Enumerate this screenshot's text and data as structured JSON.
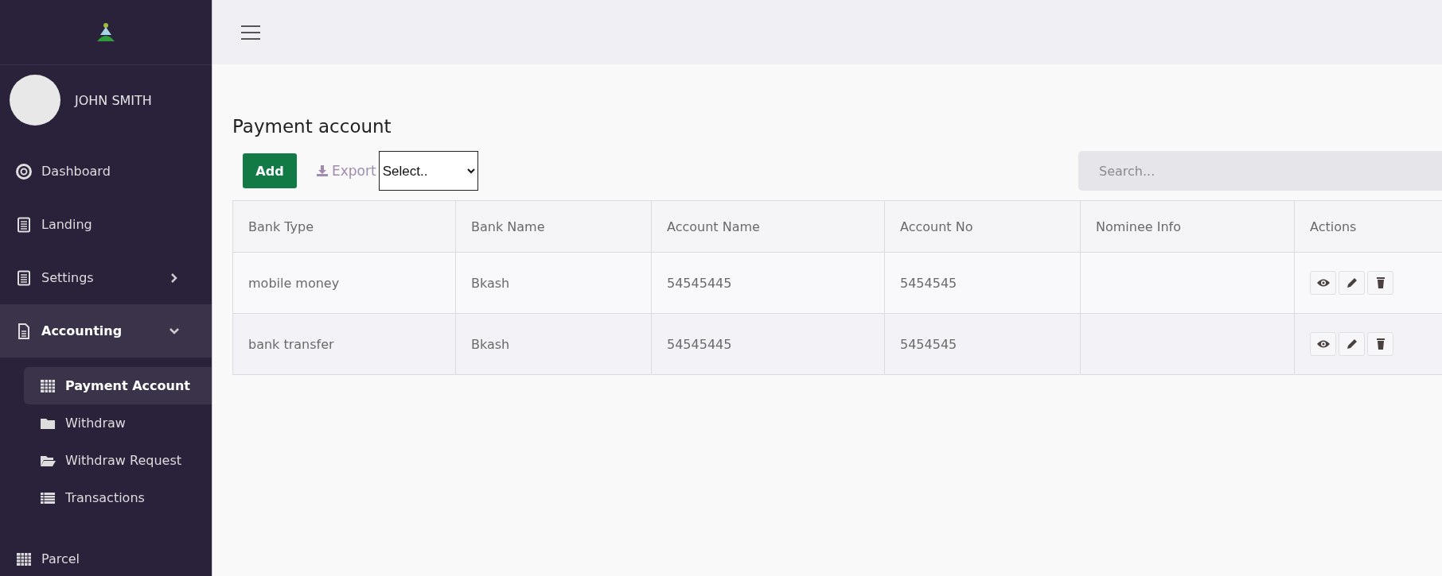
{
  "sidebar": {
    "user": {
      "name": "JOHN SMITH"
    },
    "items": [
      {
        "label": "Dashboard",
        "kind": "link",
        "selected": false
      },
      {
        "label": "Landing",
        "kind": "link",
        "selected": false
      },
      {
        "label": "Settings",
        "kind": "group",
        "selected": false,
        "expanded": false
      },
      {
        "label": "Accounting",
        "kind": "group",
        "selected": true,
        "expanded": true,
        "children": [
          {
            "label": "Payment Account",
            "selected": true
          },
          {
            "label": "Withdraw",
            "selected": false
          },
          {
            "label": "Withdraw Request",
            "selected": false
          },
          {
            "label": "Transactions",
            "selected": false
          }
        ]
      },
      {
        "label": "Parcel",
        "kind": "link",
        "selected": false
      }
    ]
  },
  "page": {
    "title": "Payment account",
    "toolbar": {
      "add_button": "Add",
      "export_label": "Export",
      "select": {
        "value": "Select.."
      },
      "search": {
        "placeholder": "Search..."
      }
    },
    "table": {
      "columns": [
        "Bank Type",
        "Bank Name",
        "Account Name",
        "Account No",
        "Nominee Info",
        "Actions"
      ],
      "rows": [
        {
          "cells": [
            "mobile money",
            "Bkash",
            "54545445",
            "5454545",
            ""
          ]
        },
        {
          "cells": [
            "bank transfer",
            "Bkash",
            "54545445",
            "5454545",
            ""
          ]
        }
      ]
    }
  }
}
